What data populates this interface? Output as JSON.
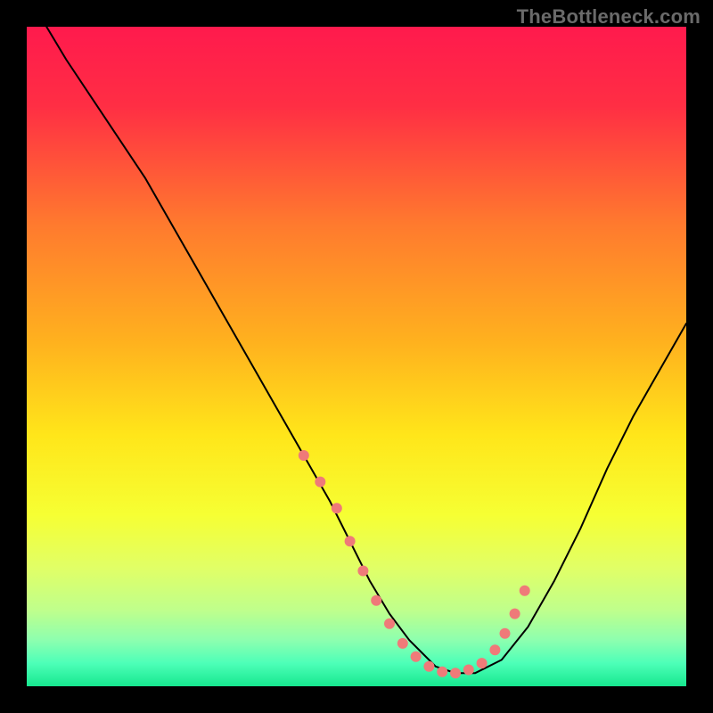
{
  "watermark": "TheBottleneck.com",
  "chart_data": {
    "type": "line",
    "title": "",
    "xlabel": "",
    "ylabel": "",
    "xlim": [
      0,
      100
    ],
    "ylim": [
      0,
      100
    ],
    "background_gradient": {
      "stops": [
        {
          "offset": 0.0,
          "color": "#ff1a4d"
        },
        {
          "offset": 0.12,
          "color": "#ff2e44"
        },
        {
          "offset": 0.3,
          "color": "#ff7a2e"
        },
        {
          "offset": 0.48,
          "color": "#ffb21e"
        },
        {
          "offset": 0.62,
          "color": "#ffe61a"
        },
        {
          "offset": 0.74,
          "color": "#f6ff33"
        },
        {
          "offset": 0.82,
          "color": "#e1ff66"
        },
        {
          "offset": 0.885,
          "color": "#bfff8c"
        },
        {
          "offset": 0.93,
          "color": "#8dffaf"
        },
        {
          "offset": 0.965,
          "color": "#4dffb8"
        },
        {
          "offset": 1.0,
          "color": "#17e88f"
        }
      ]
    },
    "series": [
      {
        "name": "curve",
        "stroke": "#000000",
        "stroke_width": 2,
        "x": [
          3,
          6,
          10,
          14,
          18,
          22,
          26,
          30,
          34,
          38,
          42,
          46,
          49,
          52,
          55,
          58,
          60,
          62,
          65,
          68,
          72,
          76,
          80,
          84,
          88,
          92,
          96,
          100
        ],
        "values": [
          100,
          95,
          89,
          83,
          77,
          70,
          63,
          56,
          49,
          42,
          35,
          28,
          22,
          16,
          11,
          7,
          5,
          3,
          2,
          2,
          4,
          9,
          16,
          24,
          33,
          41,
          48,
          55
        ]
      }
    ],
    "marker_series": {
      "name": "dots",
      "color": "#ef7a79",
      "radius": 6,
      "x": [
        42,
        44.5,
        47,
        49,
        51,
        53,
        55,
        57,
        59,
        61,
        63,
        65,
        67,
        69,
        71,
        72.5,
        74,
        75.5
      ],
      "values": [
        35,
        31,
        27,
        22,
        17.5,
        13,
        9.5,
        6.5,
        4.5,
        3,
        2.2,
        2,
        2.5,
        3.5,
        5.5,
        8,
        11,
        14.5
      ]
    }
  }
}
